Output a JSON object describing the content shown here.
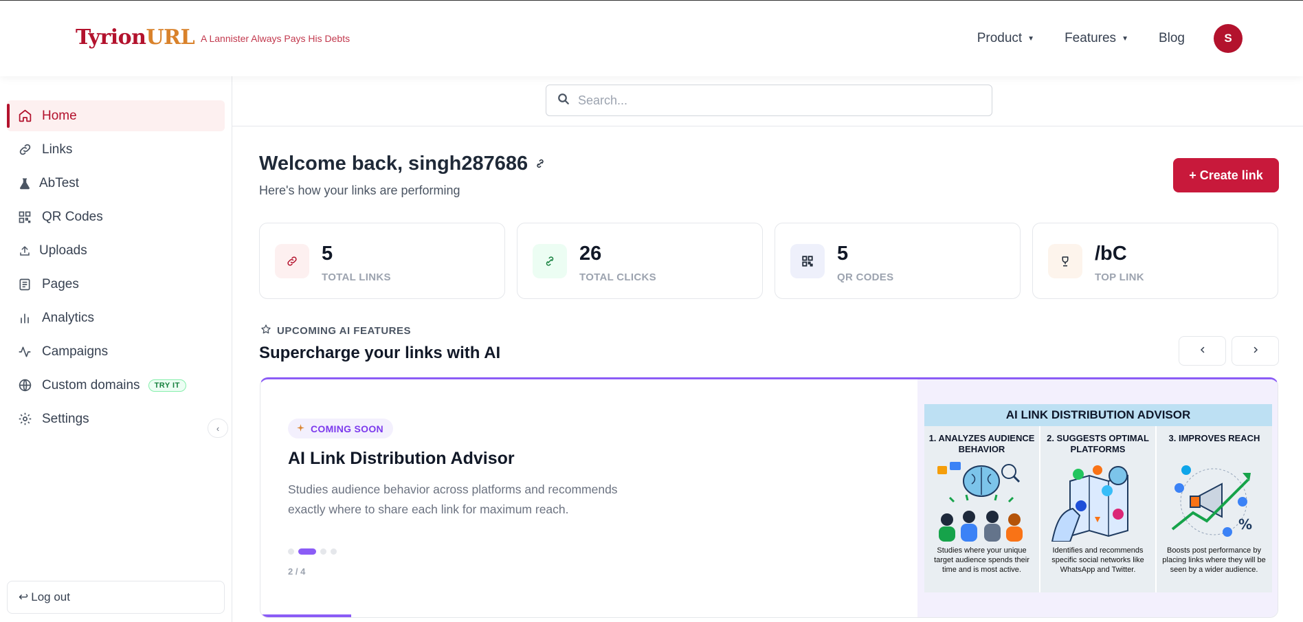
{
  "header": {
    "logo_part1": "Tyrion",
    "logo_part2": "URL",
    "tagline": "A Lannister Always Pays His Debts",
    "nav": [
      {
        "label": "Product",
        "has_caret": true
      },
      {
        "label": "Features",
        "has_caret": true
      },
      {
        "label": "Blog",
        "has_caret": false
      }
    ],
    "avatar_initial": "S",
    "colors": {
      "brand": "#b3122d",
      "accent": "#d9822b"
    }
  },
  "sidebar": {
    "items": [
      {
        "label": "Home",
        "icon": "home-icon",
        "active": true
      },
      {
        "label": "Links",
        "icon": "link-icon"
      },
      {
        "label": "AbTest",
        "icon": "flask-icon"
      },
      {
        "label": "QR Codes",
        "icon": "qr-grid-icon"
      },
      {
        "label": "Uploads",
        "icon": "upload-icon"
      },
      {
        "label": "Pages",
        "icon": "page-icon"
      },
      {
        "label": "Analytics",
        "icon": "bar-chart-icon"
      },
      {
        "label": "Campaigns",
        "icon": "activity-icon"
      },
      {
        "label": "Custom domains",
        "icon": "globe-icon",
        "badge": "TRY IT"
      },
      {
        "label": "Settings",
        "icon": "gear-icon"
      }
    ],
    "logout_label": "Log out"
  },
  "search": {
    "placeholder": "Search..."
  },
  "welcome": {
    "title": "Welcome back, singh287686",
    "subtitle": "Here's how your links are performing",
    "create_label": "+ Create link"
  },
  "stats": [
    {
      "value": "5",
      "label": "TOTAL LINKS",
      "icon": "link-icon",
      "bg": "#fdf0f0",
      "color": "#b3122d"
    },
    {
      "value": "26",
      "label": "TOTAL CLICKS",
      "icon": "click-icon",
      "bg": "#ecfdf3",
      "color": "#15803d"
    },
    {
      "value": "5",
      "label": "QR CODES",
      "icon": "qr-icon",
      "bg": "#eef0fb",
      "color": "#1f2937"
    },
    {
      "value": "/bC",
      "label": "TOP LINK",
      "icon": "trophy-icon",
      "bg": "#fdf4ec",
      "color": "#92400e"
    }
  ],
  "upcoming": {
    "eyebrow": "UPCOMING AI FEATURES",
    "title": "Supercharge your links with AI",
    "card": {
      "badge": "COMING SOON",
      "title": "AI Link Distribution Advisor",
      "description": "Studies audience behavior across platforms and recommends exactly where to share each link for maximum reach.",
      "counter": "2 / 4",
      "current_slide": 2,
      "slides": 4
    },
    "infographic": {
      "title": "AI LINK DISTRIBUTION ADVISOR",
      "columns": [
        {
          "heading": "1. ANALYZES AUDIENCE BEHAVIOR",
          "text": "Studies where your unique target audience spends their time and is most active."
        },
        {
          "heading": "2. SUGGESTS OPTIMAL PLATFORMS",
          "text": "Identifies and recommends specific social networks like WhatsApp and Twitter."
        },
        {
          "heading": "3. IMPROVES REACH",
          "text": "Boosts post performance by placing links where they will be seen by a wider audience."
        }
      ]
    }
  }
}
